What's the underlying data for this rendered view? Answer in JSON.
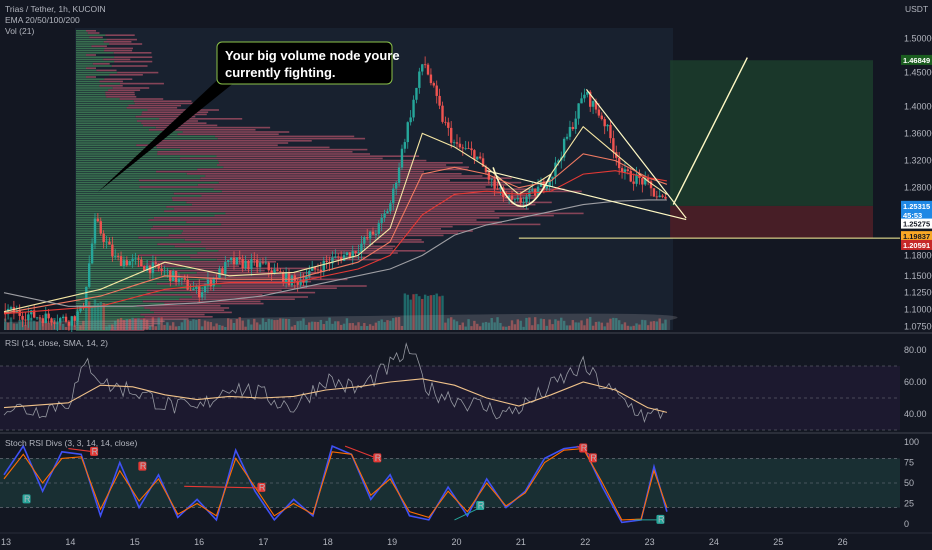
{
  "header": {
    "symbol_line": "Trias / Tether, 1h, KUCOIN",
    "ema_line": "EMA 20/50/100/200",
    "vol_line": "Vol (21)",
    "currency": "USDT"
  },
  "callout": {
    "line1": "Your big volume node youre",
    "line2": "currently fighting."
  },
  "price_tags": [
    {
      "label": "1.46849",
      "price": 1.46849,
      "bg": "#1b5e20",
      "fg": "#ffffff"
    },
    {
      "label": "1.25315",
      "price": 1.2532,
      "bg": "#1e88e5",
      "fg": "#ffffff"
    },
    {
      "label": "45:53",
      "price": 1.2395,
      "bg": "#1e88e5",
      "fg": "#ffffff"
    },
    {
      "label": "1.25275",
      "price": 1.227,
      "bg": "#ffffff",
      "fg": "#131722"
    },
    {
      "label": "1.19837",
      "price": 1.2085,
      "bg": "#f9a825",
      "fg": "#131722"
    },
    {
      "label": "1.20591",
      "price": 1.1955,
      "bg": "#c62828",
      "fg": "#ffffff"
    }
  ],
  "rsi_panel": {
    "title": "RSI (14, close, SMA, 14, 2)",
    "ticks": [
      "80.00",
      "60.00",
      "40.00"
    ]
  },
  "stoch_panel": {
    "title": "Stoch RSI Divs (3, 3, 14, 14, close)",
    "ticks": [
      "100",
      "75",
      "50",
      "25",
      "0"
    ]
  },
  "colors": {
    "background": "#131722",
    "up_candle": "#26a69a",
    "down_candle": "#ef5350",
    "ema20": "#f5e6a3",
    "ema50": "#f07a62",
    "ema100": "#e53935",
    "ema200": "#9e9ea3",
    "target_zone": "#1c3d2c",
    "stop_zone": "#4a1f27",
    "rsi_line": "#9598a1",
    "rsi_ma": "#f0c28a",
    "stoch_k": "#3f51f5",
    "stoch_d": "#ff6d00",
    "stoch_fill": "#1d3b3a"
  },
  "chart_data": {
    "type": "candlestick",
    "title": "Trias / Tether, 1h, KUCOIN",
    "y_axis": {
      "unit": "USDT",
      "range": [
        1.07,
        1.52
      ],
      "ticks": [
        1.5,
        1.45,
        1.4,
        1.36,
        1.32,
        1.28,
        1.18,
        1.15,
        1.125,
        1.1,
        1.075
      ],
      "tick_labels": [
        "1.50000",
        "1.45000",
        "1.40000",
        "1.36000",
        "1.32000",
        "1.28000",
        "1.18000",
        "1.15000",
        "1.12500",
        "1.10000",
        "1.07500"
      ]
    },
    "x_axis": {
      "range": [
        13,
        27
      ],
      "ticks": [
        13,
        14,
        15,
        16,
        17,
        18,
        19,
        20,
        21,
        22,
        23,
        24,
        25,
        26
      ],
      "tick_labels": [
        "13",
        "14",
        "15",
        "16",
        "17",
        "18",
        "19",
        "20",
        "21",
        "22",
        "23",
        "24",
        "25",
        "26"
      ]
    },
    "price_path": [
      [
        13.0,
        1.098
      ],
      [
        13.5,
        1.09
      ],
      [
        14.0,
        1.085
      ],
      [
        14.2,
        1.1
      ],
      [
        14.4,
        1.23
      ],
      [
        14.7,
        1.175
      ],
      [
        15.0,
        1.17
      ],
      [
        15.5,
        1.155
      ],
      [
        16.0,
        1.125
      ],
      [
        16.5,
        1.17
      ],
      [
        17.0,
        1.165
      ],
      [
        17.5,
        1.14
      ],
      [
        18.0,
        1.17
      ],
      [
        18.4,
        1.185
      ],
      [
        18.8,
        1.22
      ],
      [
        19.0,
        1.26
      ],
      [
        19.2,
        1.35
      ],
      [
        19.5,
        1.47
      ],
      [
        19.8,
        1.38
      ],
      [
        20.0,
        1.34
      ],
      [
        20.3,
        1.33
      ],
      [
        20.6,
        1.28
      ],
      [
        20.9,
        1.255
      ],
      [
        21.2,
        1.27
      ],
      [
        21.5,
        1.3
      ],
      [
        21.8,
        1.37
      ],
      [
        22.0,
        1.42
      ],
      [
        22.3,
        1.38
      ],
      [
        22.6,
        1.3
      ],
      [
        22.9,
        1.29
      ],
      [
        23.1,
        1.27
      ],
      [
        23.3,
        1.255
      ]
    ],
    "series": [
      {
        "name": "EMA 20",
        "points": [
          [
            13.0,
            1.097
          ],
          [
            14.5,
            1.13
          ],
          [
            15.5,
            1.17
          ],
          [
            16.5,
            1.15
          ],
          [
            17.5,
            1.155
          ],
          [
            18.5,
            1.18
          ],
          [
            19.0,
            1.22
          ],
          [
            19.5,
            1.36
          ],
          [
            20.0,
            1.34
          ],
          [
            20.5,
            1.31
          ],
          [
            21.0,
            1.27
          ],
          [
            21.5,
            1.3
          ],
          [
            22.0,
            1.37
          ],
          [
            22.5,
            1.33
          ],
          [
            23.0,
            1.29
          ],
          [
            23.3,
            1.27
          ]
        ]
      },
      {
        "name": "EMA 50",
        "points": [
          [
            13.0,
            1.095
          ],
          [
            14.5,
            1.12
          ],
          [
            15.5,
            1.15
          ],
          [
            16.5,
            1.145
          ],
          [
            17.5,
            1.145
          ],
          [
            18.5,
            1.17
          ],
          [
            19.0,
            1.2
          ],
          [
            19.5,
            1.3
          ],
          [
            20.0,
            1.31
          ],
          [
            20.5,
            1.3
          ],
          [
            21.0,
            1.28
          ],
          [
            21.5,
            1.29
          ],
          [
            22.0,
            1.33
          ],
          [
            22.5,
            1.32
          ],
          [
            23.0,
            1.295
          ],
          [
            23.3,
            1.285
          ]
        ]
      },
      {
        "name": "EMA 100",
        "points": [
          [
            13.0,
            1.094
          ],
          [
            14.5,
            1.105
          ],
          [
            15.5,
            1.13
          ],
          [
            16.5,
            1.14
          ],
          [
            17.5,
            1.14
          ],
          [
            18.5,
            1.16
          ],
          [
            19.0,
            1.18
          ],
          [
            19.5,
            1.24
          ],
          [
            20.0,
            1.27
          ],
          [
            20.5,
            1.275
          ],
          [
            21.0,
            1.27
          ],
          [
            21.5,
            1.275
          ],
          [
            22.0,
            1.3
          ],
          [
            22.5,
            1.305
          ],
          [
            23.0,
            1.295
          ],
          [
            23.3,
            1.29
          ]
        ]
      },
      {
        "name": "EMA 200",
        "points": [
          [
            13.0,
            1.125
          ],
          [
            14.0,
            1.105
          ],
          [
            15.0,
            1.105
          ],
          [
            16.0,
            1.11
          ],
          [
            17.0,
            1.12
          ],
          [
            18.0,
            1.14
          ],
          [
            19.0,
            1.16
          ],
          [
            19.5,
            1.18
          ],
          [
            20.0,
            1.21
          ],
          [
            20.5,
            1.225
          ],
          [
            21.0,
            1.235
          ],
          [
            21.5,
            1.245
          ],
          [
            22.0,
            1.255
          ],
          [
            22.5,
            1.26
          ],
          [
            23.0,
            1.262
          ],
          [
            23.3,
            1.262
          ]
        ]
      }
    ],
    "annotations": {
      "target_zone": {
        "x": [
          23.35,
          27.0
        ],
        "y": [
          1.253,
          1.468
        ]
      },
      "stop_zone": {
        "x": [
          23.35,
          27.0
        ],
        "y": [
          1.206,
          1.253
        ]
      },
      "support_line": {
        "x": [
          21.0,
          27.0
        ],
        "y": 1.2055
      },
      "wedge_upper": [
        [
          22.05,
          1.425
        ],
        [
          23.6,
          1.235
        ]
      ],
      "wedge_lower": [
        [
          20.5,
          1.305
        ],
        [
          23.6,
          1.233
        ]
      ],
      "projection": [
        [
          23.4,
          1.255
        ],
        [
          24.55,
          1.472
        ]
      ]
    }
  },
  "rsi_data": {
    "range": [
      30,
      85
    ],
    "rsi": [
      [
        13.0,
        45
      ],
      [
        13.5,
        42
      ],
      [
        14.0,
        48
      ],
      [
        14.3,
        72
      ],
      [
        14.6,
        58
      ],
      [
        15.0,
        55
      ],
      [
        15.5,
        46
      ],
      [
        16.0,
        42
      ],
      [
        16.5,
        58
      ],
      [
        17.0,
        52
      ],
      [
        17.5,
        44
      ],
      [
        18.0,
        62
      ],
      [
        18.5,
        55
      ],
      [
        19.0,
        70
      ],
      [
        19.3,
        80
      ],
      [
        19.6,
        55
      ],
      [
        20.0,
        50
      ],
      [
        20.4,
        45
      ],
      [
        20.8,
        40
      ],
      [
        21.2,
        48
      ],
      [
        21.6,
        60
      ],
      [
        22.0,
        70
      ],
      [
        22.3,
        58
      ],
      [
        22.7,
        46
      ],
      [
        23.0,
        38
      ],
      [
        23.3,
        42
      ]
    ],
    "rsi_ma": [
      [
        13.0,
        44
      ],
      [
        14.0,
        47
      ],
      [
        14.5,
        58
      ],
      [
        15.0,
        57
      ],
      [
        15.5,
        52
      ],
      [
        16.0,
        49
      ],
      [
        16.5,
        51
      ],
      [
        17.0,
        50
      ],
      [
        17.5,
        51
      ],
      [
        18.0,
        55
      ],
      [
        18.5,
        57
      ],
      [
        19.0,
        60
      ],
      [
        19.5,
        62
      ],
      [
        20.0,
        58
      ],
      [
        20.5,
        50
      ],
      [
        21.0,
        45
      ],
      [
        21.5,
        52
      ],
      [
        22.0,
        60
      ],
      [
        22.5,
        55
      ],
      [
        23.0,
        44
      ],
      [
        23.3,
        41
      ]
    ]
  },
  "stoch_data": {
    "range": [
      0,
      100
    ],
    "k": [
      [
        13.0,
        60
      ],
      [
        13.3,
        95
      ],
      [
        13.6,
        40
      ],
      [
        13.9,
        88
      ],
      [
        14.2,
        85
      ],
      [
        14.5,
        10
      ],
      [
        14.8,
        75
      ],
      [
        15.1,
        20
      ],
      [
        15.4,
        60
      ],
      [
        15.7,
        8
      ],
      [
        16.0,
        30
      ],
      [
        16.3,
        5
      ],
      [
        16.6,
        90
      ],
      [
        16.9,
        40
      ],
      [
        17.2,
        5
      ],
      [
        17.5,
        30
      ],
      [
        17.8,
        10
      ],
      [
        18.1,
        95
      ],
      [
        18.4,
        85
      ],
      [
        18.7,
        30
      ],
      [
        19.0,
        60
      ],
      [
        19.3,
        10
      ],
      [
        19.6,
        5
      ],
      [
        19.9,
        45
      ],
      [
        20.2,
        10
      ],
      [
        20.5,
        55
      ],
      [
        20.8,
        20
      ],
      [
        21.1,
        40
      ],
      [
        21.4,
        80
      ],
      [
        21.7,
        92
      ],
      [
        22.0,
        95
      ],
      [
        22.3,
        45
      ],
      [
        22.6,
        2
      ],
      [
        22.9,
        5
      ],
      [
        23.1,
        70
      ],
      [
        23.3,
        15
      ]
    ],
    "d": [
      [
        13.0,
        55
      ],
      [
        13.3,
        85
      ],
      [
        13.6,
        50
      ],
      [
        13.9,
        80
      ],
      [
        14.2,
        82
      ],
      [
        14.5,
        18
      ],
      [
        14.8,
        65
      ],
      [
        15.1,
        28
      ],
      [
        15.4,
        55
      ],
      [
        15.7,
        12
      ],
      [
        16.0,
        25
      ],
      [
        16.3,
        10
      ],
      [
        16.6,
        80
      ],
      [
        16.9,
        45
      ],
      [
        17.2,
        10
      ],
      [
        17.5,
        25
      ],
      [
        17.8,
        12
      ],
      [
        18.1,
        88
      ],
      [
        18.4,
        85
      ],
      [
        18.7,
        35
      ],
      [
        19.0,
        55
      ],
      [
        19.3,
        15
      ],
      [
        19.6,
        8
      ],
      [
        19.9,
        40
      ],
      [
        20.2,
        15
      ],
      [
        20.5,
        50
      ],
      [
        20.8,
        22
      ],
      [
        21.1,
        38
      ],
      [
        21.4,
        75
      ],
      [
        21.7,
        90
      ],
      [
        22.0,
        92
      ],
      [
        22.3,
        50
      ],
      [
        22.6,
        5
      ],
      [
        22.9,
        6
      ],
      [
        23.1,
        65
      ],
      [
        23.3,
        20
      ]
    ],
    "markers": [
      {
        "label": "R",
        "x": 14.4,
        "y": 88,
        "color": "#e53935"
      },
      {
        "label": "R",
        "x": 15.15,
        "y": 70,
        "color": "#e53935"
      },
      {
        "label": "R",
        "x": 17.0,
        "y": 44,
        "color": "#e53935"
      },
      {
        "label": "R",
        "x": 18.8,
        "y": 80,
        "color": "#e53935"
      },
      {
        "label": "R",
        "x": 22.0,
        "y": 92,
        "color": "#e53935"
      },
      {
        "label": "R",
        "x": 22.15,
        "y": 80,
        "color": "#e53935"
      },
      {
        "label": "R",
        "x": 13.35,
        "y": 30,
        "color": "#26a69a"
      },
      {
        "label": "R",
        "x": 20.4,
        "y": 22,
        "color": "#26a69a"
      },
      {
        "label": "R",
        "x": 23.2,
        "y": 5,
        "color": "#26a69a"
      }
    ]
  }
}
